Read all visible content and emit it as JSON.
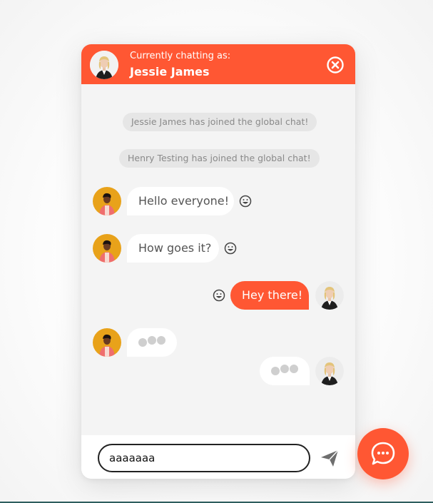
{
  "colors": {
    "accent": "#ff5733",
    "window_bg": "#f4f4f4",
    "bubble_in": "#ffffff",
    "system_pill": "#e6e6e6"
  },
  "header": {
    "subtitle": "Currently chatting as:",
    "user_name": "Jessie James",
    "close_icon": "close-circle-icon"
  },
  "messages": {
    "system": [
      "Jessie James has joined the global chat!",
      "Henry Testing has joined the global chat!"
    ],
    "chat": [
      {
        "from": "Henry Testing",
        "direction": "incoming",
        "text": "Hello everyone!",
        "reaction_icon": "smiley-icon"
      },
      {
        "from": "Henry Testing",
        "direction": "incoming",
        "text": "How goes it?",
        "reaction_icon": "smiley-icon"
      },
      {
        "from": "Jessie James",
        "direction": "outgoing",
        "text": "Hey there!",
        "reaction_icon": "smiley-icon"
      }
    ],
    "typing": [
      {
        "from": "Henry Testing",
        "direction": "incoming"
      },
      {
        "from": "Jessie James",
        "direction": "outgoing"
      }
    ]
  },
  "composer": {
    "value": "aaaaaaa",
    "placeholder": "",
    "send_icon": "paper-plane-icon"
  },
  "launcher": {
    "icon": "chat-bubble-icon"
  }
}
